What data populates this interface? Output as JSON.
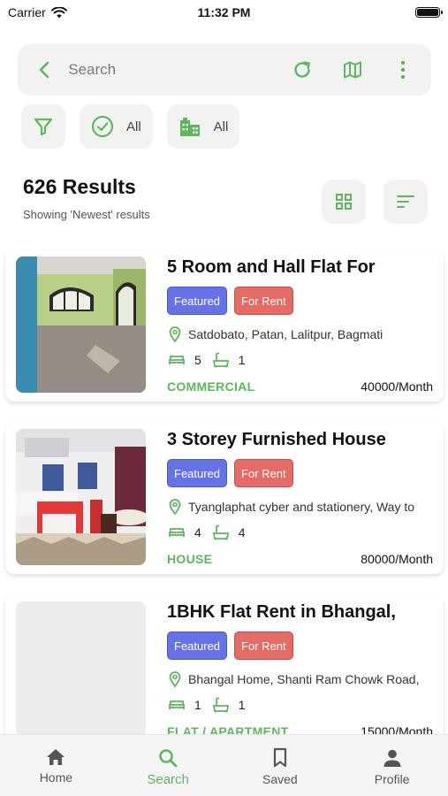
{
  "status_bar": {
    "carrier": "Carrier",
    "time": "11:32 PM",
    "battery_level": 1.0
  },
  "search": {
    "placeholder": "Search"
  },
  "filters": {
    "status_label": "All",
    "type_label": "All"
  },
  "results": {
    "count_text": "626 Results",
    "subtitle": "Showing 'Newest' results"
  },
  "listings": [
    {
      "title": "5 Room and Hall Flat For",
      "badge_featured": "Featured",
      "badge_rent": "For Rent",
      "location": "Satdobato, Patan, Lalitpur, Bagmati",
      "beds": "5",
      "baths": "1",
      "category": "COMMERCIAL",
      "price": "40000/Month"
    },
    {
      "title": "3 Storey Furnished House",
      "badge_featured": "Featured",
      "badge_rent": "For Rent",
      "location": "Tyanglaphat cyber and stationery, Way to",
      "beds": "4",
      "baths": "4",
      "category": "HOUSE",
      "price": "80000/Month"
    },
    {
      "title": "1BHK Flat Rent in Bhangal,",
      "badge_featured": "Featured",
      "badge_rent": "For Rent",
      "location": "Bhangal Home, Shanti Ram Chowk Road,",
      "beds": "1",
      "baths": "1",
      "category": "FLAT / APARTMENT",
      "price": "15000/Month"
    }
  ],
  "nav": {
    "home": "Home",
    "search": "Search",
    "saved": "Saved",
    "profile": "Profile"
  },
  "colors": {
    "accent": "#5cb85c",
    "featured": "#6673e8",
    "for_rent": "#e56b65",
    "chip_bg": "#f2f3f1"
  },
  "icons": [
    "back-arrow-icon",
    "refresh-icon",
    "map-icon",
    "more-vertical-icon",
    "filter-icon",
    "check-circle-icon",
    "buildings-icon",
    "grid-view-icon",
    "sort-icon",
    "location-pin-icon",
    "bed-icon",
    "bath-icon",
    "home-icon",
    "search-icon",
    "bookmark-icon",
    "person-icon"
  ]
}
